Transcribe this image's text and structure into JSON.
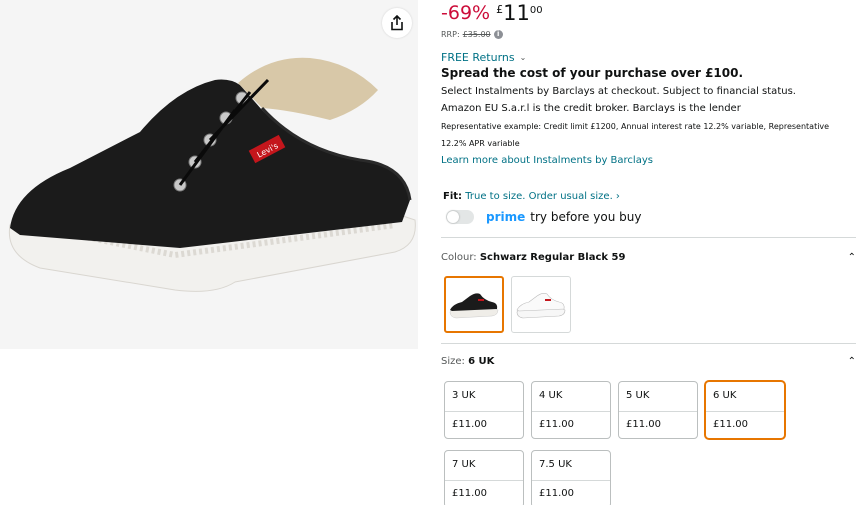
{
  "price": {
    "discount": "-69%",
    "currency": "£",
    "whole": "11",
    "fraction": "00",
    "rrp_label": "RRP:",
    "rrp_value": "£35.00"
  },
  "returns": {
    "label": "FREE Returns"
  },
  "instalments": {
    "headline": "Spread the cost of your purchase over £100.",
    "line1": "Select Instalments by Barclays at checkout. Subject to financial status.",
    "line2": "Amazon EU S.a.r.l is the credit broker. Barclays is the lender",
    "representative1": "Representative example: Credit limit £1200, Annual interest rate 12.2% variable, Representative",
    "representative2": "12.2% APR variable",
    "learn_more": "Learn more about Instalments by Barclays"
  },
  "fit": {
    "label": "Fit:",
    "value": "True to size. Order usual size. ›"
  },
  "prime": {
    "word": "prime",
    "text": "try before you buy",
    "toggle_on": false
  },
  "colour": {
    "label": "Colour:",
    "selected": "Schwarz Regular Black 59",
    "options": [
      {
        "name": "black-shoe",
        "selected": true
      },
      {
        "name": "white-shoe",
        "selected": false
      }
    ]
  },
  "size": {
    "label": "Size:",
    "selected": "6 UK",
    "options": [
      {
        "size": "3 UK",
        "price": "£11.00",
        "selected": false
      },
      {
        "size": "4 UK",
        "price": "£11.00",
        "selected": false
      },
      {
        "size": "5 UK",
        "price": "£11.00",
        "selected": false
      },
      {
        "size": "6 UK",
        "price": "£11.00",
        "selected": true
      },
      {
        "size": "7 UK",
        "price": "£11.00",
        "selected": false
      },
      {
        "size": "7.5 UK",
        "price": "£11.00",
        "selected": false
      }
    ]
  },
  "product_image": {
    "brand_tag": "Levi's"
  },
  "colors": {
    "discount": "#cc0c39",
    "link": "#007185",
    "selected_border": "#e77600",
    "prime": "#1a98ff"
  }
}
